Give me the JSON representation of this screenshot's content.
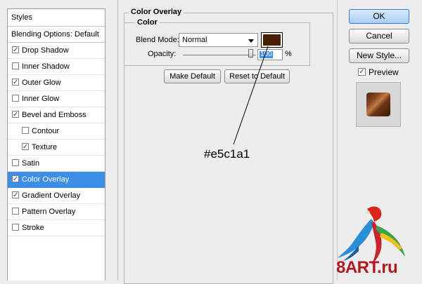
{
  "styles_panel": {
    "header": "Styles",
    "blending_options": "Blending Options: Default",
    "items": [
      {
        "label": "Drop Shadow",
        "checked": true
      },
      {
        "label": "Inner Shadow",
        "checked": false
      },
      {
        "label": "Outer Glow",
        "checked": true
      },
      {
        "label": "Inner Glow",
        "checked": false
      },
      {
        "label": "Bevel and Emboss",
        "checked": true
      },
      {
        "label": "Contour",
        "checked": false,
        "indent": true
      },
      {
        "label": "Texture",
        "checked": true,
        "indent": true
      },
      {
        "label": "Satin",
        "checked": false
      },
      {
        "label": "Color Overlay",
        "checked": true,
        "selected": true
      },
      {
        "label": "Gradient Overlay",
        "checked": true
      },
      {
        "label": "Pattern Overlay",
        "checked": false
      },
      {
        "label": "Stroke",
        "checked": false
      }
    ]
  },
  "color_overlay": {
    "group_title": "Color Overlay",
    "subgroup_title": "Color",
    "blend_mode_label": "Blend Mode:",
    "blend_mode_value": "Normal",
    "swatch_color": "#4a1d05",
    "opacity_label": "Opacity:",
    "opacity_value": "100",
    "opacity_unit": "%",
    "opacity_fraction": 1.0,
    "make_default_label": "Make Default",
    "reset_default_label": "Reset to Default"
  },
  "annotation": {
    "text": "#e5c1a1"
  },
  "right_panel": {
    "ok_label": "OK",
    "cancel_label": "Cancel",
    "new_style_label": "New Style...",
    "preview_label": "Preview",
    "preview_checked": true
  },
  "watermark": {
    "text_main": "8ART",
    "text_dot": ".",
    "text_tld": "ru"
  },
  "colors": {
    "selection": "#3d8ee6",
    "ok_border": "#3b7bd0",
    "watermark_red": "#b01b22"
  }
}
